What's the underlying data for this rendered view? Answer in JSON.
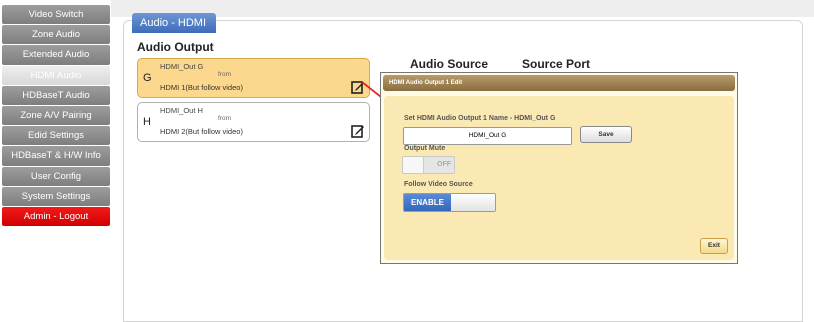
{
  "sidebar": {
    "items": [
      {
        "label": "Video Switch"
      },
      {
        "label": "Zone Audio"
      },
      {
        "label": "Extended Audio"
      },
      {
        "label": "HDMI Audio"
      },
      {
        "label": "HDBaseT Audio"
      },
      {
        "label": "Zone A/V Pairing"
      },
      {
        "label": "Edid Settings"
      },
      {
        "label": "HDBaseT & H/W Info"
      },
      {
        "label": "User Config"
      },
      {
        "label": "System Settings"
      },
      {
        "label": "Admin - Logout"
      }
    ]
  },
  "tab": {
    "label": "Audio - HDMI"
  },
  "headers": {
    "audio_output": "Audio Output",
    "audio_source": "Audio Source",
    "source_port": "Source Port"
  },
  "outputs": [
    {
      "letter": "G",
      "name": "HDMI_Out G",
      "from": "from",
      "source": "HDMI 1(But follow video)"
    },
    {
      "letter": "H",
      "name": "HDMI_Out H",
      "from": "from",
      "source": "HDMI 2(But follow video)"
    }
  ],
  "dialog": {
    "title": "HDMI Audio Output 1 Edit",
    "name_label": "Set HDMI Audio Output 1 Name - HDMI_Out G",
    "name_value": "HDMI_Out G",
    "save_label": "Save",
    "mute_label": "Output Mute",
    "mute_state": "OFF",
    "follow_label": "Follow Video Source",
    "follow_state": "ENABLE",
    "exit_label": "Exit"
  },
  "colors": {
    "accent_blue": "#3d6cb8",
    "selected_bg": "#fbd88d",
    "logout_red": "#e00000",
    "arrow_red": "#e3242b"
  }
}
